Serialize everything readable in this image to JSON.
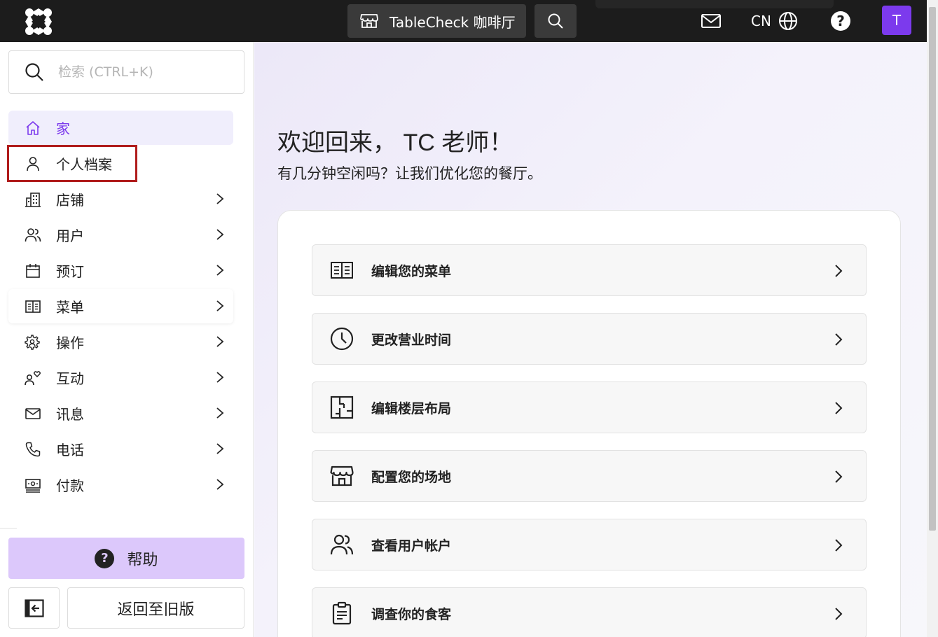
{
  "topbar": {
    "store_name": "TableCheck 咖啡厅",
    "language": "CN",
    "help_glyph": "?",
    "avatar_initial": "T"
  },
  "sidebar": {
    "search_placeholder": "检索 (CTRL+K)",
    "items": [
      {
        "label": "家",
        "icon": "home-icon",
        "active": true
      },
      {
        "label": "个人档案",
        "icon": "user-icon"
      },
      {
        "label": "店铺",
        "icon": "building-icon"
      },
      {
        "label": "用户",
        "icon": "users-icon"
      },
      {
        "label": "预订",
        "icon": "calendar-icon"
      },
      {
        "label": "菜单",
        "icon": "menu-book-icon"
      },
      {
        "label": "操作",
        "icon": "gear-person-icon"
      },
      {
        "label": "互动",
        "icon": "engagement-icon"
      },
      {
        "label": "讯息",
        "icon": "mail-icon"
      },
      {
        "label": "电话",
        "icon": "phone-icon"
      },
      {
        "label": "付款",
        "icon": "payment-icon"
      }
    ],
    "help_label": "帮助",
    "legacy_label": "返回至旧版"
  },
  "main": {
    "welcome": "欢迎回来， TC 老师！",
    "subtitle": "有几分钟空闲吗？让我们优化您的餐厅。",
    "actions": [
      {
        "label": "编辑您的菜单",
        "icon": "menu-book-icon"
      },
      {
        "label": "更改营业时间",
        "icon": "clock-icon"
      },
      {
        "label": "编辑楼层布局",
        "icon": "floor-plan-icon"
      },
      {
        "label": "配置您的场地",
        "icon": "storefront-icon"
      },
      {
        "label": "查看用户帐户",
        "icon": "users-icon"
      },
      {
        "label": "调查你的食客",
        "icon": "clipboard-icon"
      }
    ]
  },
  "colors": {
    "accent": "#7c3aed",
    "help_bg": "#dcc8fb",
    "topbar_bg": "#1c1c1c",
    "highlight_border": "#b01c1c"
  }
}
